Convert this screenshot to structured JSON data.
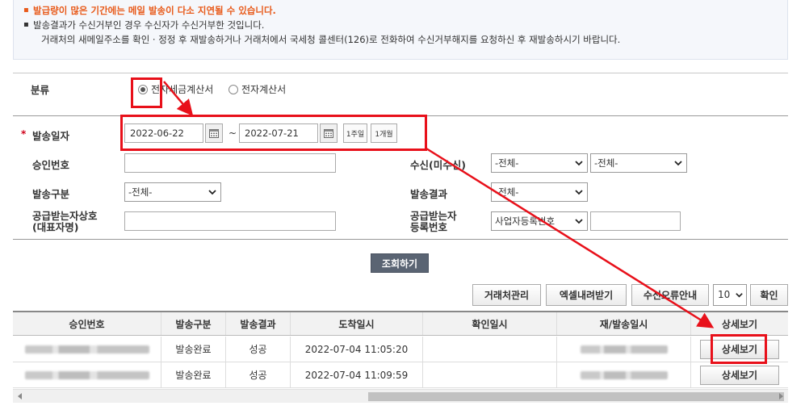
{
  "notice": {
    "warning": "발급량이 많은 기간에는 메일 발송이 다소 지연될 수 있습니다.",
    "line2": "발송결과가 수신거부인 경우 수신자가 수신거부한 것입니다.",
    "line3": "거래처의 새메일주소를 확인 · 정정 후 재발송하거나 거래처에서 국세청 콜센터(126)로 전화하여 수신거부해지를 요청하신 후 재발송하시기 바랍니다."
  },
  "filter": {
    "category_label": "분류",
    "category_options": [
      "전자세금계산서",
      "전자계산서"
    ],
    "category_selected": "전자세금계산서",
    "send_date_label": "발송일자",
    "date_from": "2022-06-22",
    "date_to": "2022-07-21",
    "tilde": "~",
    "quick_1week": "1주일",
    "quick_1month": "1개월",
    "approval_no_label": "승인번호",
    "approval_no_value": "",
    "receipt_label": "수신(미수신)",
    "receipt_select1": "-전체-",
    "receipt_select2": "-전체-",
    "send_type_label": "발송구분",
    "send_type_select": "-전체-",
    "send_result_label": "발송결과",
    "send_result_select": "-전체-",
    "buyer_name_label_1": "공급받는자상호",
    "buyer_name_label_2": "(대표자명)",
    "buyer_name_value": "",
    "buyer_reg_label_1": "공급받는자",
    "buyer_reg_label_2": "등록번호",
    "buyer_reg_select": "사업자등록번호",
    "buyer_reg_value": "",
    "search_button": "조회하기"
  },
  "toolbar": {
    "client_mgmt": "거래처관리",
    "excel_download": "엑셀내려받기",
    "receipt_error_guide": "수신오류안내",
    "per_page": "10",
    "confirm": "확인"
  },
  "table": {
    "columns": [
      "승인번호",
      "발송구분",
      "발송결과",
      "도착일시",
      "확인일시",
      "재/발송일시",
      "상세보기"
    ],
    "rows": [
      {
        "send_type": "발송완료",
        "result": "성공",
        "arrival": "2022-07-04 11:05:20",
        "confirm": "",
        "detail": "상세보기"
      },
      {
        "send_type": "발송완료",
        "result": "성공",
        "arrival": "2022-07-04 11:09:59",
        "confirm": "",
        "detail": "상세보기"
      }
    ]
  },
  "colors": {
    "warning_text": "#e85a1a",
    "annotation_red": "#e8101a",
    "search_button_bg": "#5a6473"
  }
}
